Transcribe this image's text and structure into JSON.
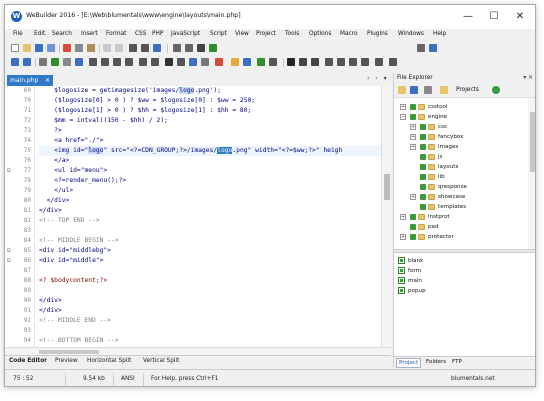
{
  "window": {
    "title": "WeBuilder 2016 - [E:\\Web\\blumentals\\www\\engine\\layouts\\main.php]",
    "app_icon": "W",
    "minimize": "—",
    "maximize": "☐",
    "close": "✕"
  },
  "menu": [
    "File",
    "Edit",
    "Search",
    "Insert",
    "Format",
    "CSS",
    "PHP",
    "JavaScript",
    "Script",
    "View",
    "Project",
    "Tools",
    "Options",
    "Macro",
    "Plugins",
    "Windows",
    "Help"
  ],
  "tab": {
    "label": "main.php",
    "close": "✕",
    "nav": "‹ › ▾"
  },
  "code": {
    "lines": [
      {
        "n": "69",
        "fold": ""
      },
      {
        "n": "70",
        "fold": ""
      },
      {
        "n": "71",
        "fold": ""
      },
      {
        "n": "72",
        "fold": ""
      },
      {
        "n": "73",
        "fold": ""
      },
      {
        "n": "74",
        "fold": ""
      },
      {
        "n": "75",
        "fold": ""
      },
      {
        "n": "76",
        "fold": ""
      },
      {
        "n": "77",
        "fold": "⊟"
      },
      {
        "n": "78",
        "fold": ""
      },
      {
        "n": "79",
        "fold": ""
      },
      {
        "n": "80",
        "fold": ""
      },
      {
        "n": "81",
        "fold": ""
      },
      {
        "n": "82",
        "fold": ""
      },
      {
        "n": "83",
        "fold": ""
      },
      {
        "n": "84",
        "fold": ""
      },
      {
        "n": "85",
        "fold": "⊟"
      },
      {
        "n": "86",
        "fold": "⊟"
      },
      {
        "n": "87",
        "fold": ""
      },
      {
        "n": "88",
        "fold": ""
      },
      {
        "n": "89",
        "fold": ""
      },
      {
        "n": "90",
        "fold": ""
      },
      {
        "n": "91",
        "fold": ""
      },
      {
        "n": "92",
        "fold": ""
      },
      {
        "n": "93",
        "fold": ""
      },
      {
        "n": "94",
        "fold": ""
      }
    ],
    "l69a": "    $logosize = getimagesize('images/",
    "l69b": "logo",
    "l69c": ".png');",
    "l70": "    ($logosize[0] > 0 ) ? $ww = $logosize[0] : $ww = 250;",
    "l71": "    ($logosize[1] > 0 ) ? $hh = $logosize[1] : $hh = 80;",
    "l72": "    $mm = intval((150 - $hh) / 2);",
    "l73": "    ?>",
    "l74": "    <a href=\"./\">",
    "l75a": "    <img id=\"",
    "l75b": "logo",
    "l75c": "\" src=\"<?=CDN_GROUP;?>/images/",
    "l75d": "logo",
    "l75e": ".png\" width=\"<?=$ww;?>\" heigh",
    "l76": "    </a>",
    "l77": "    <ul id=\"menu\">",
    "l78": "    <?=render_menu();?>",
    "l79": "    </ul>",
    "l80": "  </div>",
    "l81": "</div>",
    "l82": "<!-- TOP END -->",
    "l83": "",
    "l84": "<!-- MIDDLE BEGIN -->",
    "l85": "<div id=\"middlebg\">",
    "l86": "<div id=\"middle\">",
    "l87": "",
    "l88": "<? $bodycontent;?>",
    "l89": "",
    "l90": "</div>",
    "l91": "</div>",
    "l92": "<!-- MIDDLE END -->",
    "l93": "",
    "l94": "<!-- BOTTOM BEGIN -->"
  },
  "bottom_tabs": [
    "Code Editor",
    "Preview",
    "Horizontal Split",
    "Vertical Split"
  ],
  "explorer": {
    "title": "File Explorer",
    "pin": "▾ ✕",
    "projects": "Projects",
    "tree": [
      {
        "label": "csstool",
        "level": 0,
        "exp": "+",
        "type": "folder"
      },
      {
        "label": "engine",
        "level": 0,
        "exp": "−",
        "type": "folder"
      },
      {
        "label": "css",
        "level": 1,
        "exp": "+",
        "type": "folder"
      },
      {
        "label": "fancybox",
        "level": 1,
        "exp": "+",
        "type": "folder"
      },
      {
        "label": "images",
        "level": 1,
        "exp": "+",
        "type": "folder"
      },
      {
        "label": "js",
        "level": 1,
        "exp": "",
        "type": "folder"
      },
      {
        "label": "layouts",
        "level": 1,
        "exp": "",
        "type": "folder"
      },
      {
        "label": "lib",
        "level": 1,
        "exp": "",
        "type": "folder"
      },
      {
        "label": "qresponse",
        "level": 1,
        "exp": "",
        "type": "folder"
      },
      {
        "label": "showcase",
        "level": 1,
        "exp": "+",
        "type": "folder"
      },
      {
        "label": "templates",
        "level": 1,
        "exp": "",
        "type": "folder"
      },
      {
        "label": "instprot",
        "level": 0,
        "exp": "+",
        "type": "folder"
      },
      {
        "label": "pad",
        "level": 0,
        "exp": "",
        "type": "folder"
      },
      {
        "label": "protector",
        "level": 0,
        "exp": "+",
        "type": "folder"
      }
    ],
    "files": [
      "blank",
      "form",
      "main",
      "popup"
    ],
    "tabs": [
      "Project",
      "Folders",
      "FTP"
    ]
  },
  "status": {
    "pos": "75 : 52",
    "size": "9.54 kb",
    "enc": "ANSI",
    "help": "For Help, press Ctrl+F1",
    "brand": "blumentals.net"
  }
}
